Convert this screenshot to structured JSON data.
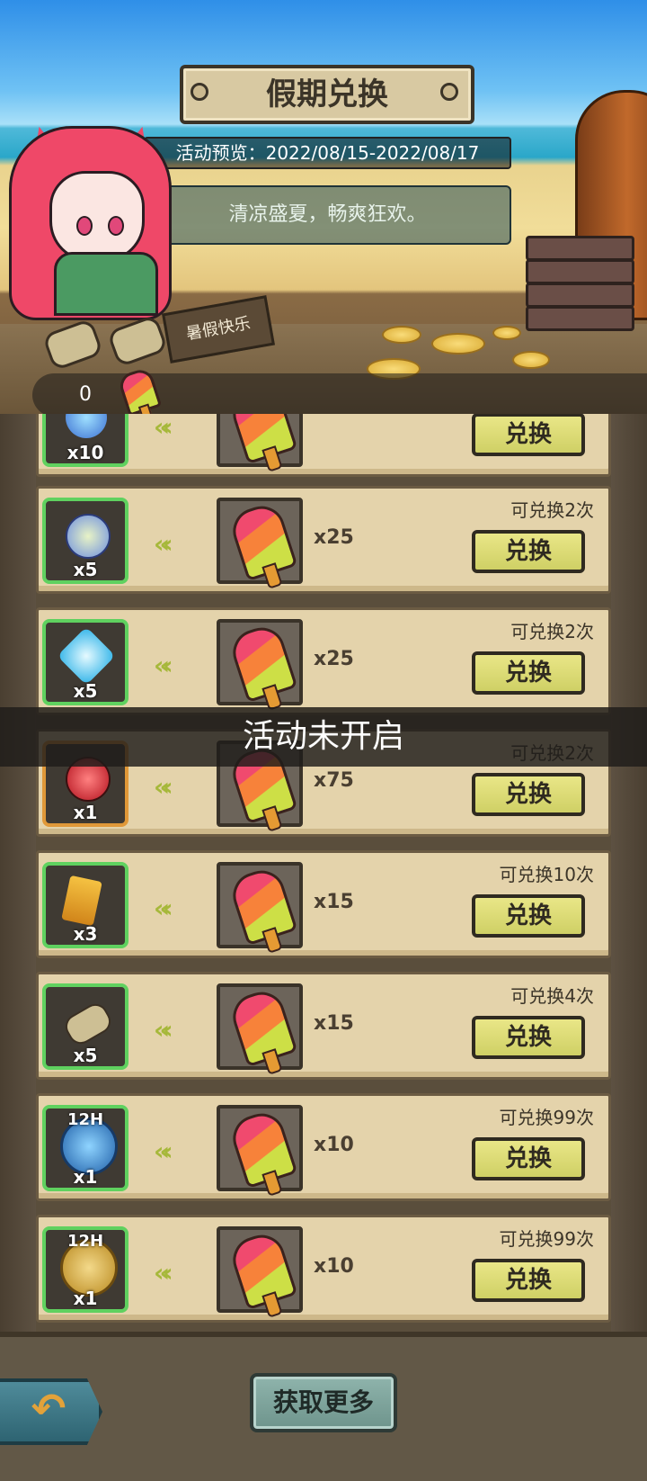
{
  "header": {
    "title": "假期兑换",
    "date_label": "活动预览：2022/08/15-2022/08/17",
    "slogan": "清凉盛夏，畅爽狂欢。",
    "sign_text": "暑假快乐"
  },
  "currency": {
    "count": "0",
    "icon": "popsicle-icon"
  },
  "rows": [
    {
      "item": "gem",
      "item_qty": "x10",
      "cost_qty": "",
      "limit": "",
      "button": "兑换",
      "frame": "green"
    },
    {
      "item": "blue-flower-gem",
      "item_qty": "x5",
      "cost_qty": "x25",
      "limit": "可兑换2次",
      "button": "兑换",
      "frame": "green"
    },
    {
      "item": "blue-crystal",
      "item_qty": "x5",
      "cost_qty": "x25",
      "limit": "可兑换2次",
      "button": "兑换",
      "frame": "green"
    },
    {
      "item": "red-potion",
      "item_qty": "x1",
      "cost_qty": "x75",
      "limit": "可兑换2次",
      "button": "兑换",
      "frame": "orange"
    },
    {
      "item": "vip-card",
      "item_qty": "x3",
      "cost_qty": "x15",
      "limit": "可兑换10次",
      "button": "兑换",
      "frame": "green"
    },
    {
      "item": "scroll",
      "item_qty": "x5",
      "cost_qty": "x15",
      "limit": "可兑换4次",
      "button": "兑换",
      "frame": "green"
    },
    {
      "item": "blue-12h-coin",
      "item_qty": "x1",
      "item_label": "12H",
      "cost_qty": "x10",
      "limit": "可兑换99次",
      "button": "兑换",
      "frame": "green"
    },
    {
      "item": "gold-12h-coin",
      "item_qty": "x1",
      "item_label": "12H",
      "cost_qty": "x10",
      "limit": "可兑换99次",
      "button": "兑换",
      "frame": "green"
    }
  ],
  "notice": "活动未开启",
  "footer": {
    "more_button": "获取更多",
    "back_icon": "back-arrow-icon"
  },
  "colors": {
    "button": "#cfd065",
    "frame_green": "#5fd15f",
    "frame_orange": "#e09838"
  }
}
